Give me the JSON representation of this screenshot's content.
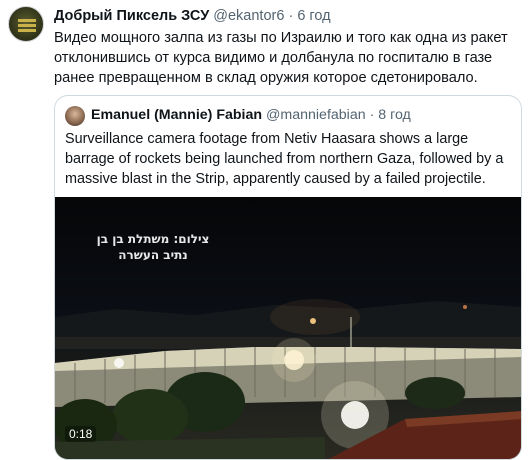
{
  "tweet": {
    "author_name": "Добрый Пиксель ЗСУ",
    "author_handle": "@ekantor6",
    "separator": "·",
    "time": "6 год",
    "text": "Видео мощного залпа из газы по Израилю и того как одна из ракет отклонившись от курса видимо и долбанула по госпиталю в газе ранее превращенном в склад оружия которое сдетонировало."
  },
  "quoted_tweet": {
    "author_name": "Emanuel (Mannie) Fabian",
    "author_handle": "@manniefabian",
    "separator": "·",
    "time": "8 год",
    "text": "Surveillance camera footage from Netiv Haasara shows a large barrage of rockets being launched from northern Gaza, followed by a massive blast in the Strip, apparently caused by a failed projectile.",
    "video": {
      "overlay_line1": "צילום: משתלת בן בן",
      "overlay_line2": "נתיב העשרה",
      "duration": "0:18"
    }
  }
}
